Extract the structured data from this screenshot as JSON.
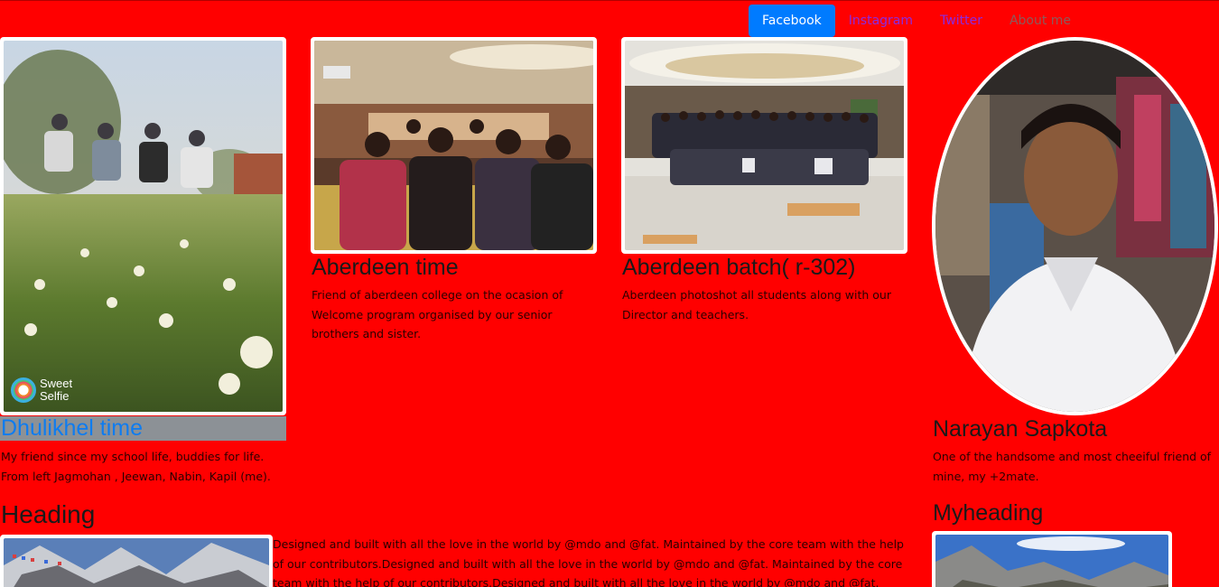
{
  "nav": {
    "items": [
      {
        "label": "Facebook"
      },
      {
        "label": "Instagram"
      },
      {
        "label": "Twitter"
      },
      {
        "label": "About me"
      }
    ]
  },
  "cards": {
    "dhulikhel": {
      "title": "Dhulikhel time",
      "text": "My friend since my school life, buddies for life. From left Jagmohan , Jeewan, Nabin, Kapil (me).",
      "watermark": "Sweet Selfie"
    },
    "aberdeen_time": {
      "title": "Aberdeen time",
      "text": "Friend of aberdeen college on the ocasion of Welcome program organised by our senior brothers and sister."
    },
    "aberdeen_batch": {
      "title": "Aberdeen batch( r-302)",
      "text": "Aberdeen photoshot all students along with our Director and teachers."
    },
    "narayan": {
      "title": "Narayan Sapkota",
      "text": "One of the handsome and most cheeiful friend of mine, my +2mate."
    }
  },
  "section": {
    "heading": "Heading",
    "text": "Designed and built with all the love in the world by @mdo and @fat. Maintained by the core team with the help of our contributors.Designed and built with all the love in the world by @mdo and @fat. Maintained by the core team with the help of our contributors.Designed and built with all the love in the world by @mdo and @fat.",
    "side_heading": "Myheading"
  }
}
